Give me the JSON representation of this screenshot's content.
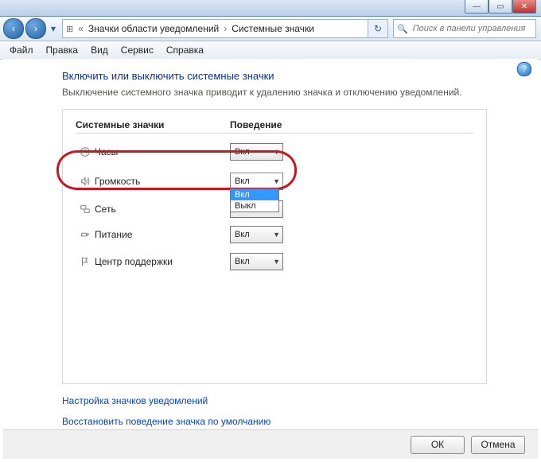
{
  "breadcrumb": {
    "b1": "Значки области уведомлений",
    "b2": "Системные значки"
  },
  "search": {
    "placeholder": "Поиск в панели управления"
  },
  "menu": {
    "file": "Файл",
    "edit": "Правка",
    "view": "Вид",
    "service": "Сервис",
    "help": "Справка"
  },
  "heading": "Включить или выключить системные значки",
  "subtext": "Выключение системного значка приводит к удалению значка и отключению уведомлений.",
  "columns": {
    "c1": "Системные значки",
    "c2": "Поведение"
  },
  "rows": {
    "clock": {
      "label": "Часы",
      "value": "Вкл"
    },
    "volume": {
      "label": "Громкость",
      "value": "Вкл"
    },
    "net": {
      "label": "Сеть",
      "value": "Вкл"
    },
    "power": {
      "label": "Питание",
      "value": "Вкл"
    },
    "action": {
      "label": "Центр поддержки",
      "value": "Вкл"
    }
  },
  "dropdown": {
    "opt_on": "Вкл",
    "opt_off": "Выкл"
  },
  "links": {
    "customize": "Настройка значков уведомлений",
    "restore": "Восстановить поведение значка по умолчанию"
  },
  "buttons": {
    "ok": "ОК",
    "cancel": "Отмена"
  }
}
